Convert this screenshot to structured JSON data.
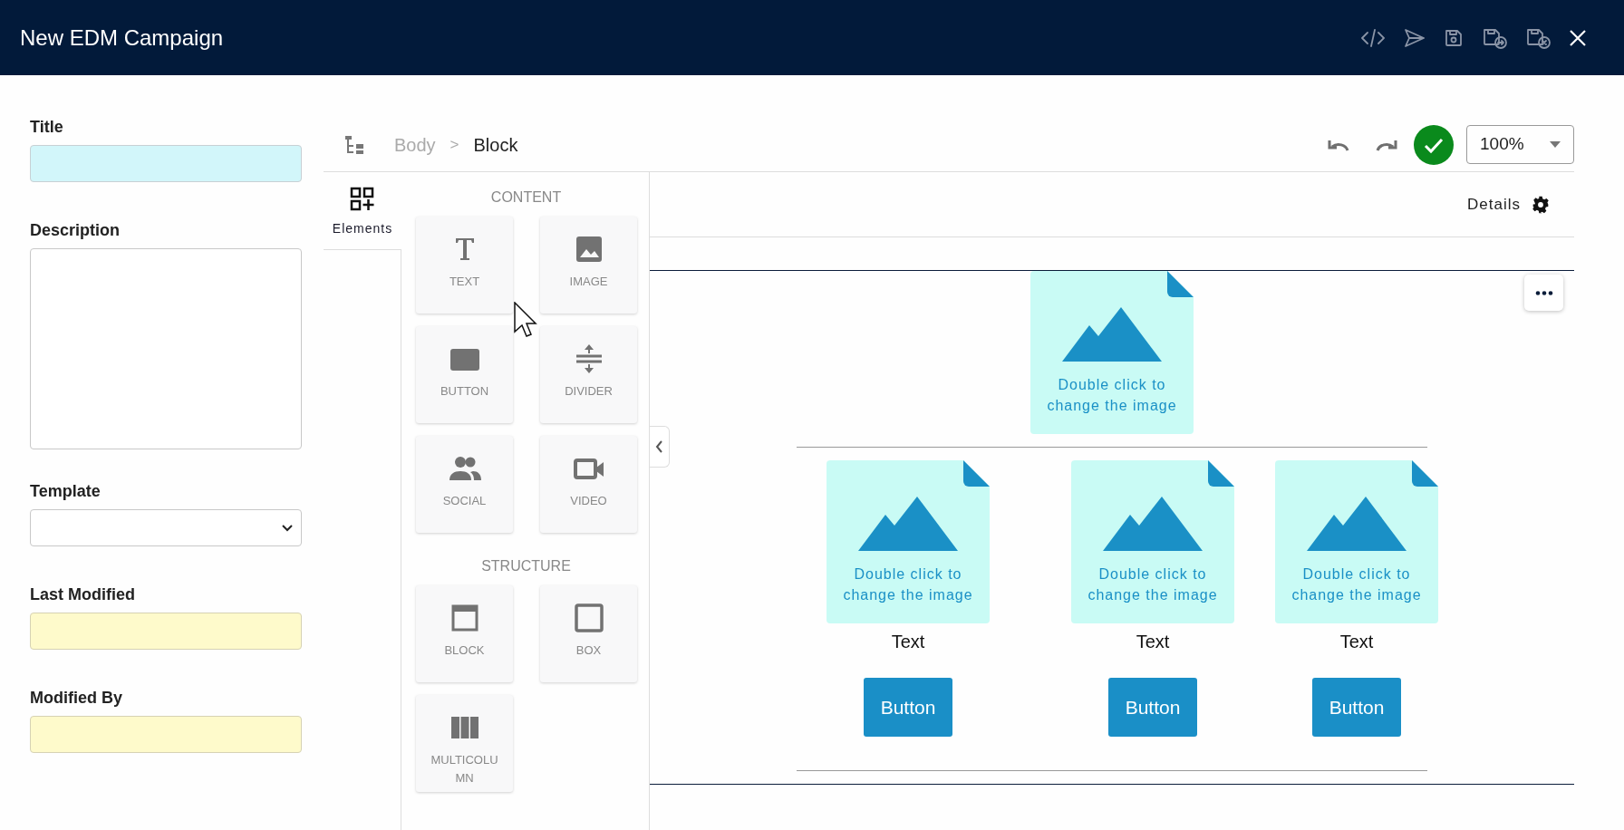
{
  "header": {
    "title": "New EDM Campaign",
    "actions": [
      {
        "kind": "code"
      },
      {
        "kind": "send"
      },
      {
        "kind": "save"
      },
      {
        "kind": "save-copy"
      },
      {
        "kind": "save-discard"
      },
      {
        "kind": "close"
      }
    ]
  },
  "form": [
    {
      "label": "Title",
      "kind": "highlighted"
    },
    {
      "label": "Description",
      "kind": "textarea"
    },
    {
      "label": "Template",
      "kind": "select"
    },
    {
      "label": "Last Modified",
      "kind": "readonly"
    },
    {
      "label": "Modified By",
      "kind": "readonly"
    }
  ],
  "breadcrumb": {
    "separator": ">",
    "items": [
      {
        "label": "Body",
        "selected": false
      },
      {
        "label": "Block",
        "selected": true
      }
    ]
  },
  "zoom": {
    "value": "100%"
  },
  "side_tab": {
    "label": "Elements"
  },
  "palette": [
    {
      "title": "CONTENT",
      "items": [
        {
          "label": "TEXT",
          "kind": "text"
        },
        {
          "label": "IMAGE",
          "kind": "image"
        },
        {
          "label": "BUTTON",
          "kind": "button"
        },
        {
          "label": "DIVIDER",
          "kind": "divider"
        },
        {
          "label": "SOCIAL",
          "kind": "social"
        },
        {
          "label": "VIDEO",
          "kind": "video"
        }
      ]
    },
    {
      "title": "STRUCTURE",
      "items": [
        {
          "label": "BLOCK",
          "kind": "block"
        },
        {
          "label": "BOX",
          "kind": "box"
        },
        {
          "label": "MULTICOLUMN",
          "kind": "multicolumn"
        }
      ]
    }
  ],
  "canvas": {
    "details": "Details",
    "hero": {
      "caption": "Double click to change the image"
    },
    "columns": [
      {
        "caption": "Double click to change the image",
        "text": "Text",
        "button": "Button"
      },
      {
        "caption": "Double click to change the image",
        "text": "Text",
        "button": "Button"
      },
      {
        "caption": "Double click to change the image",
        "text": "Text",
        "button": "Button"
      }
    ]
  }
}
